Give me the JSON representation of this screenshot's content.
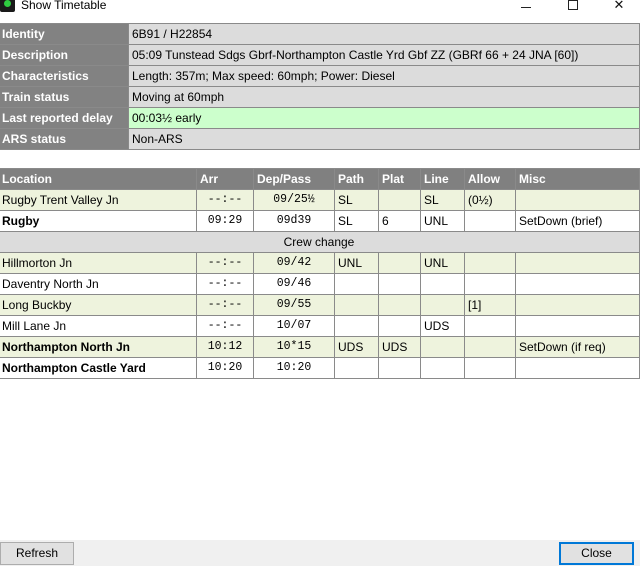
{
  "window": {
    "title": "Show Timetable",
    "minimize_glyph": "—",
    "maximize_glyph": "☐",
    "close_glyph": "✕"
  },
  "info": [
    {
      "key": "Identity",
      "value": "6B91 / H22854"
    },
    {
      "key": "Description",
      "value": "05:09 Tunstead Sdgs Gbrf-Northampton Castle Yrd Gbf ZZ (GBRf 66 + 24 JNA [60])"
    },
    {
      "key": "Characteristics",
      "value": "Length: 357m; Max speed: 60mph; Power: Diesel"
    },
    {
      "key": "Train status",
      "value": "Moving at 60mph"
    },
    {
      "key": "Last reported delay",
      "value": "00:03½ early"
    },
    {
      "key": "ARS status",
      "value": "Non-ARS"
    }
  ],
  "timetable": {
    "headers": [
      "Location",
      "Arr",
      "Dep/Pass",
      "Path",
      "Plat",
      "Line",
      "Allow",
      "Misc"
    ],
    "rows": [
      {
        "location": "Rugby Trent Valley Jn",
        "arr": "--:--",
        "dep": "09/25½",
        "path": "SL",
        "plat": "",
        "line": "SL",
        "allow": "(0½)",
        "misc": ""
      },
      {
        "location": "Rugby",
        "arr": "09:29",
        "dep": "09d39",
        "path": "SL",
        "plat": "6",
        "line": "UNL",
        "allow": "",
        "misc": "SetDown (brief)"
      },
      {
        "crew": "Crew change"
      },
      {
        "location": "Hillmorton Jn",
        "arr": "--:--",
        "dep": "09/42",
        "path": "UNL",
        "plat": "",
        "line": "UNL",
        "allow": "",
        "misc": ""
      },
      {
        "location": "Daventry North Jn",
        "arr": "--:--",
        "dep": "09/46",
        "path": "",
        "plat": "",
        "line": "",
        "allow": "",
        "misc": ""
      },
      {
        "location": "Long Buckby",
        "arr": "--:--",
        "dep": "09/55",
        "path": "",
        "plat": "",
        "line": "",
        "allow": "[1]",
        "misc": ""
      },
      {
        "location": "Mill Lane Jn",
        "arr": "--:--",
        "dep": "10/07",
        "path": "",
        "plat": "",
        "line": "UDS",
        "allow": "",
        "misc": ""
      },
      {
        "location": "Northampton North Jn",
        "arr": "10:12",
        "dep": "10*15",
        "path": "UDS",
        "plat": "UDS",
        "line": "",
        "allow": "",
        "misc": "SetDown (if req)"
      },
      {
        "location": "Northampton Castle Yard",
        "arr": "10:20",
        "dep": "10:20",
        "path": "",
        "plat": "",
        "line": "",
        "allow": "",
        "misc": ""
      }
    ]
  },
  "buttons": {
    "refresh": "Refresh",
    "close": "Close"
  }
}
